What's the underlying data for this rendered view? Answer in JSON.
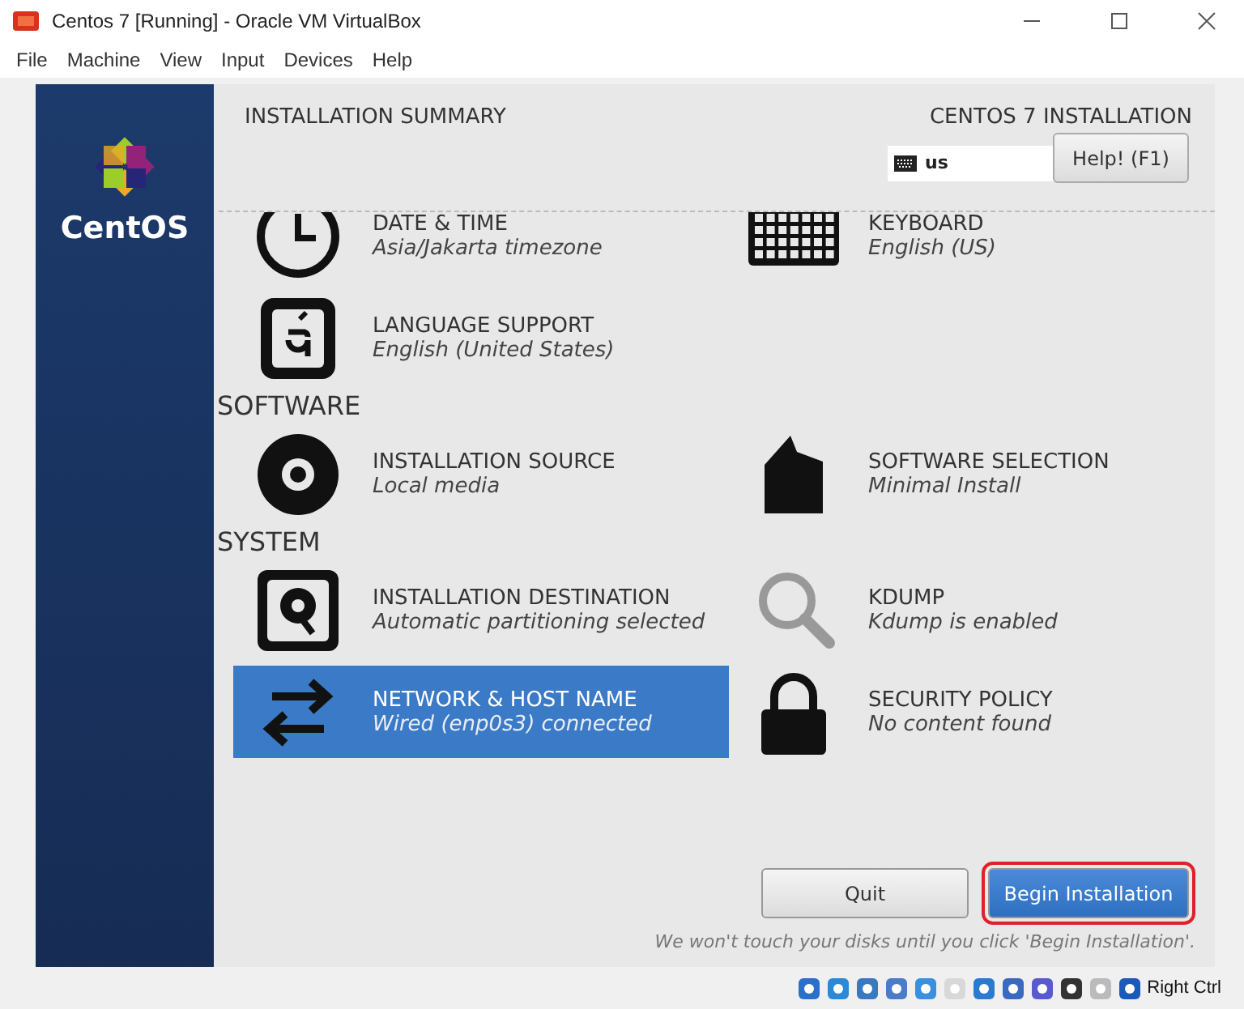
{
  "window": {
    "title": "Centos 7 [Running] - Oracle VM VirtualBox"
  },
  "menu": [
    "File",
    "Machine",
    "View",
    "Input",
    "Devices",
    "Help"
  ],
  "sidebar": {
    "logo_text": "CentOS"
  },
  "header": {
    "title": "INSTALLATION SUMMARY",
    "product": "CENTOS 7 INSTALLATION",
    "keyboard_layout": "us",
    "help_button": "Help! (F1)"
  },
  "sections": [
    {
      "spokes": [
        {
          "kind": "clock",
          "title": "DATE & TIME",
          "status": "Asia/Jakarta timezone",
          "selected": false
        },
        {
          "kind": "keyboard",
          "title": "KEYBOARD",
          "status": "English (US)",
          "selected": false
        },
        {
          "kind": "language",
          "title": "LANGUAGE SUPPORT",
          "status": "English (United States)",
          "selected": false
        }
      ]
    },
    {
      "title": "SOFTWARE",
      "spokes": [
        {
          "kind": "disc",
          "title": "INSTALLATION SOURCE",
          "status": "Local media",
          "selected": false
        },
        {
          "kind": "package",
          "title": "SOFTWARE SELECTION",
          "status": "Minimal Install",
          "selected": false
        }
      ]
    },
    {
      "title": "SYSTEM",
      "spokes": [
        {
          "kind": "disk",
          "title": "INSTALLATION DESTINATION",
          "status": "Automatic partitioning selected",
          "selected": false
        },
        {
          "kind": "search",
          "title": "KDUMP",
          "status": "Kdump is enabled",
          "selected": false
        },
        {
          "kind": "network",
          "title": "NETWORK & HOST NAME",
          "status": "Wired (enp0s3) connected",
          "selected": true
        },
        {
          "kind": "lock",
          "title": "SECURITY POLICY",
          "status": "No content found",
          "selected": false
        }
      ]
    }
  ],
  "buttons": [
    {
      "label": "Quit",
      "kind": "plain"
    },
    {
      "label": "Begin Installation",
      "kind": "primary"
    }
  ],
  "footer_note": "We won't touch your disks until you click 'Begin Installation'.",
  "status_bar": {
    "host_key": "Right Ctrl"
  }
}
